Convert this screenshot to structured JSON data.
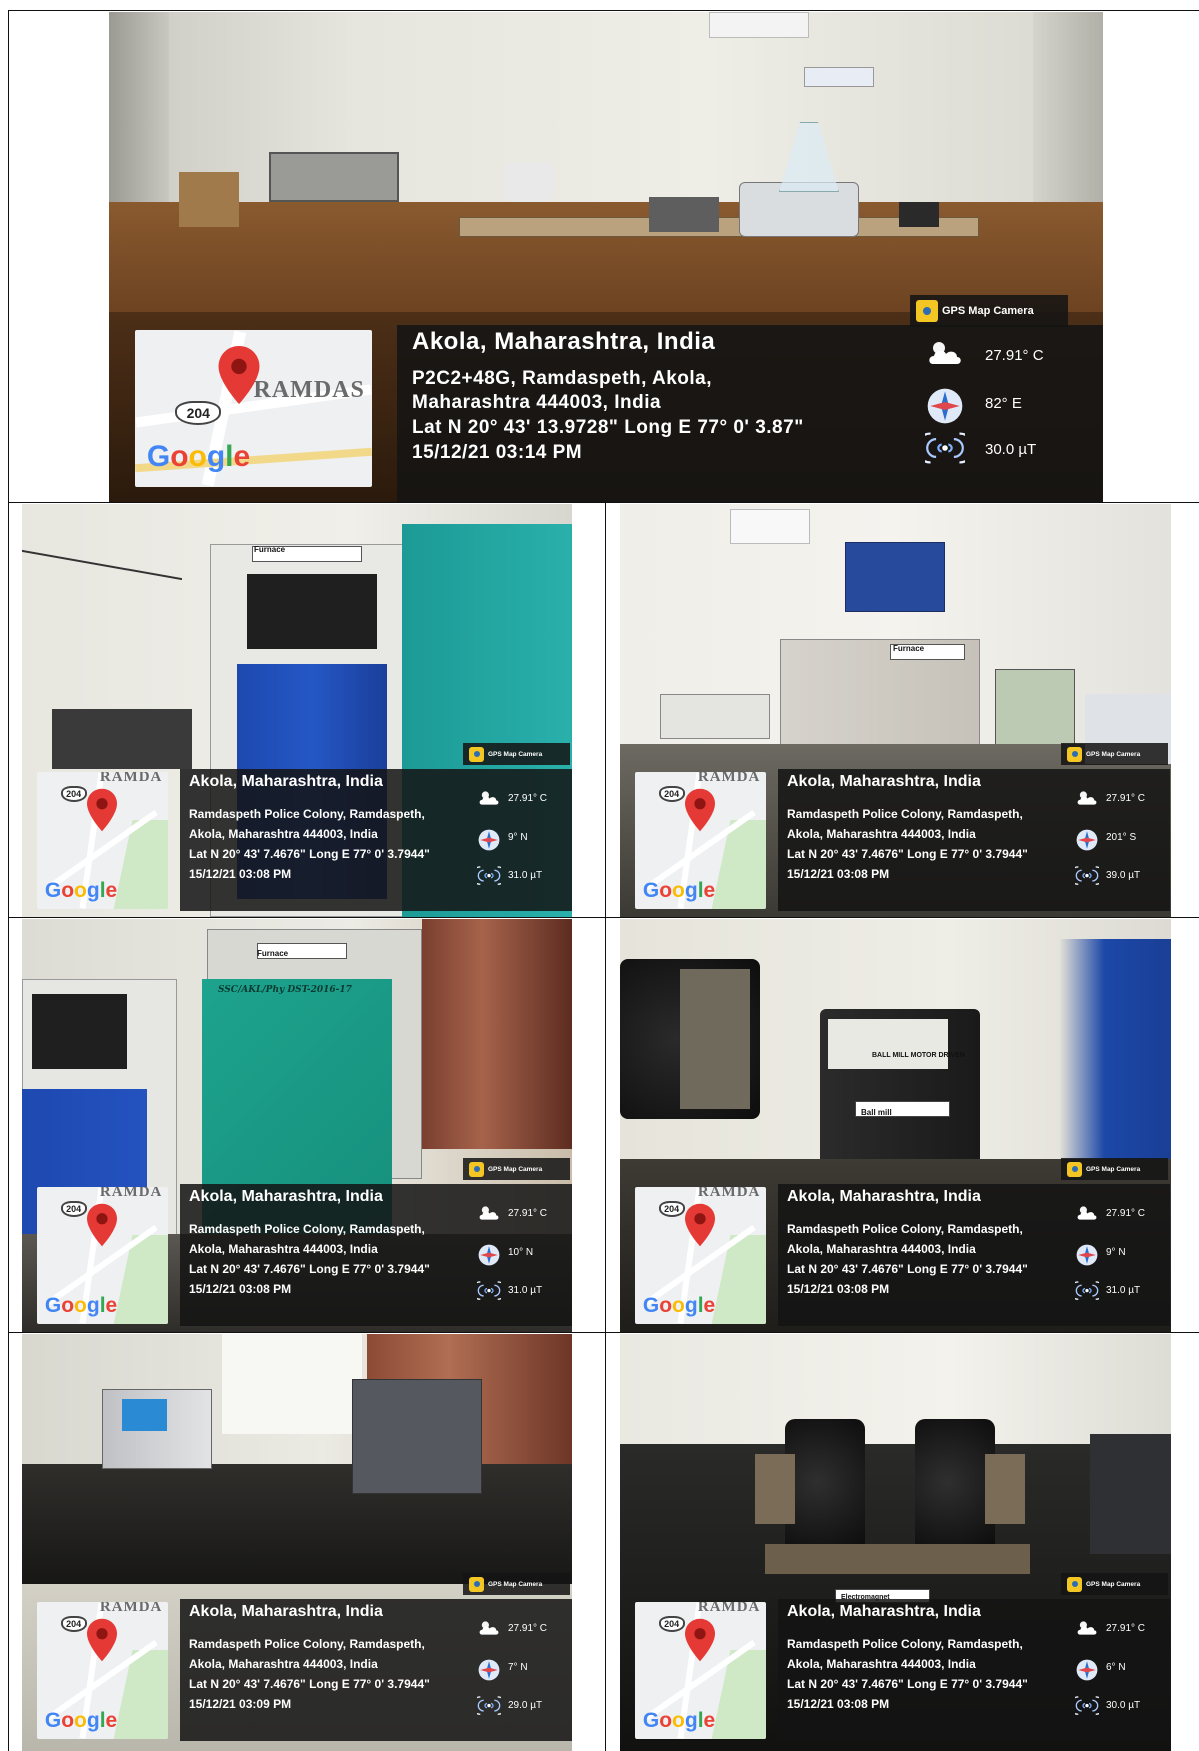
{
  "gps_badge": "GPS Map Camera",
  "map_highway": "204",
  "map_area": "RAMDAS",
  "map_area_small": "RAMDA",
  "google_letters": [
    "G",
    "o",
    "o",
    "g",
    "l",
    "e"
  ],
  "panels": [
    {
      "city": "Akola, Maharashtra, India",
      "address_1": "P2C2+48G, Ramdaspeth, Akola,",
      "address_2": "Maharashtra 444003, India",
      "coords": "Lat N 20° 43' 13.9728\" Long E 77° 0' 3.87\"",
      "datetime": "15/12/21 03:14 PM",
      "temperature": "27.91° C",
      "direction": "82° E",
      "magnetic": "30.0 µT"
    },
    {
      "city": "Akola, Maharashtra, India",
      "address_1": "Ramdaspeth Police Colony, Ramdaspeth,",
      "address_2": "Akola, Maharashtra 444003, India",
      "coords": "Lat N 20° 43' 7.4676\" Long E 77° 0' 3.7944\"",
      "datetime": "15/12/21 03:08 PM",
      "temperature": "27.91° C",
      "direction": "9° N",
      "magnetic": "31.0 µT",
      "labels": [
        "Furnace"
      ]
    },
    {
      "city": "Akola, Maharashtra, India",
      "address_1": "Ramdaspeth Police Colony, Ramdaspeth,",
      "address_2": "Akola, Maharashtra 444003, India",
      "coords": "Lat N 20° 43' 7.4676\" Long E 77° 0' 3.7944\"",
      "datetime": "15/12/21 03:08 PM",
      "temperature": "27.91° C",
      "direction": "201° S",
      "magnetic": "39.0 µT",
      "labels": [
        "Furnace"
      ]
    },
    {
      "city": "Akola, Maharashtra, India",
      "address_1": "Ramdaspeth Police Colony, Ramdaspeth,",
      "address_2": "Akola, Maharashtra 444003, India",
      "coords": "Lat N 20° 43' 7.4676\" Long E 77° 0' 3.7944\"",
      "datetime": "15/12/21 03:08 PM",
      "temperature": "27.91° C",
      "direction": "10° N",
      "magnetic": "31.0 µT",
      "labels": [
        "Furnace",
        "SSC/AKL/Phy DST-2016-17"
      ]
    },
    {
      "city": "Akola, Maharashtra, India",
      "address_1": "Ramdaspeth Police Colony, Ramdaspeth,",
      "address_2": "Akola, Maharashtra 444003, India",
      "coords": "Lat N 20° 43' 7.4676\" Long E 77° 0' 3.7944\"",
      "datetime": "15/12/21 03:08 PM",
      "temperature": "27.91° C",
      "direction": "9° N",
      "magnetic": "31.0 µT",
      "labels": [
        "BALL MILL MOTOR DRIVEN",
        "Ball mill"
      ]
    },
    {
      "city": "Akola, Maharashtra, India",
      "address_1": "Ramdaspeth Police Colony, Ramdaspeth,",
      "address_2": "Akola, Maharashtra 444003, India",
      "coords": "Lat N 20° 43' 7.4676\" Long E 77° 0' 3.7944\"",
      "datetime": "15/12/21 03:09 PM",
      "temperature": "27.91° C",
      "direction": "7° N",
      "magnetic": "29.0 µT"
    },
    {
      "city": "Akola, Maharashtra, India",
      "address_1": "Ramdaspeth Police Colony, Ramdaspeth,",
      "address_2": "Akola, Maharashtra 444003, India",
      "coords": "Lat N 20° 43' 7.4676\" Long E 77° 0' 3.7944\"",
      "datetime": "15/12/21 03:08 PM",
      "temperature": "27.91° C",
      "direction": "6° N",
      "magnetic": "30.0 µT",
      "labels": [
        "Electromagnet"
      ]
    }
  ]
}
